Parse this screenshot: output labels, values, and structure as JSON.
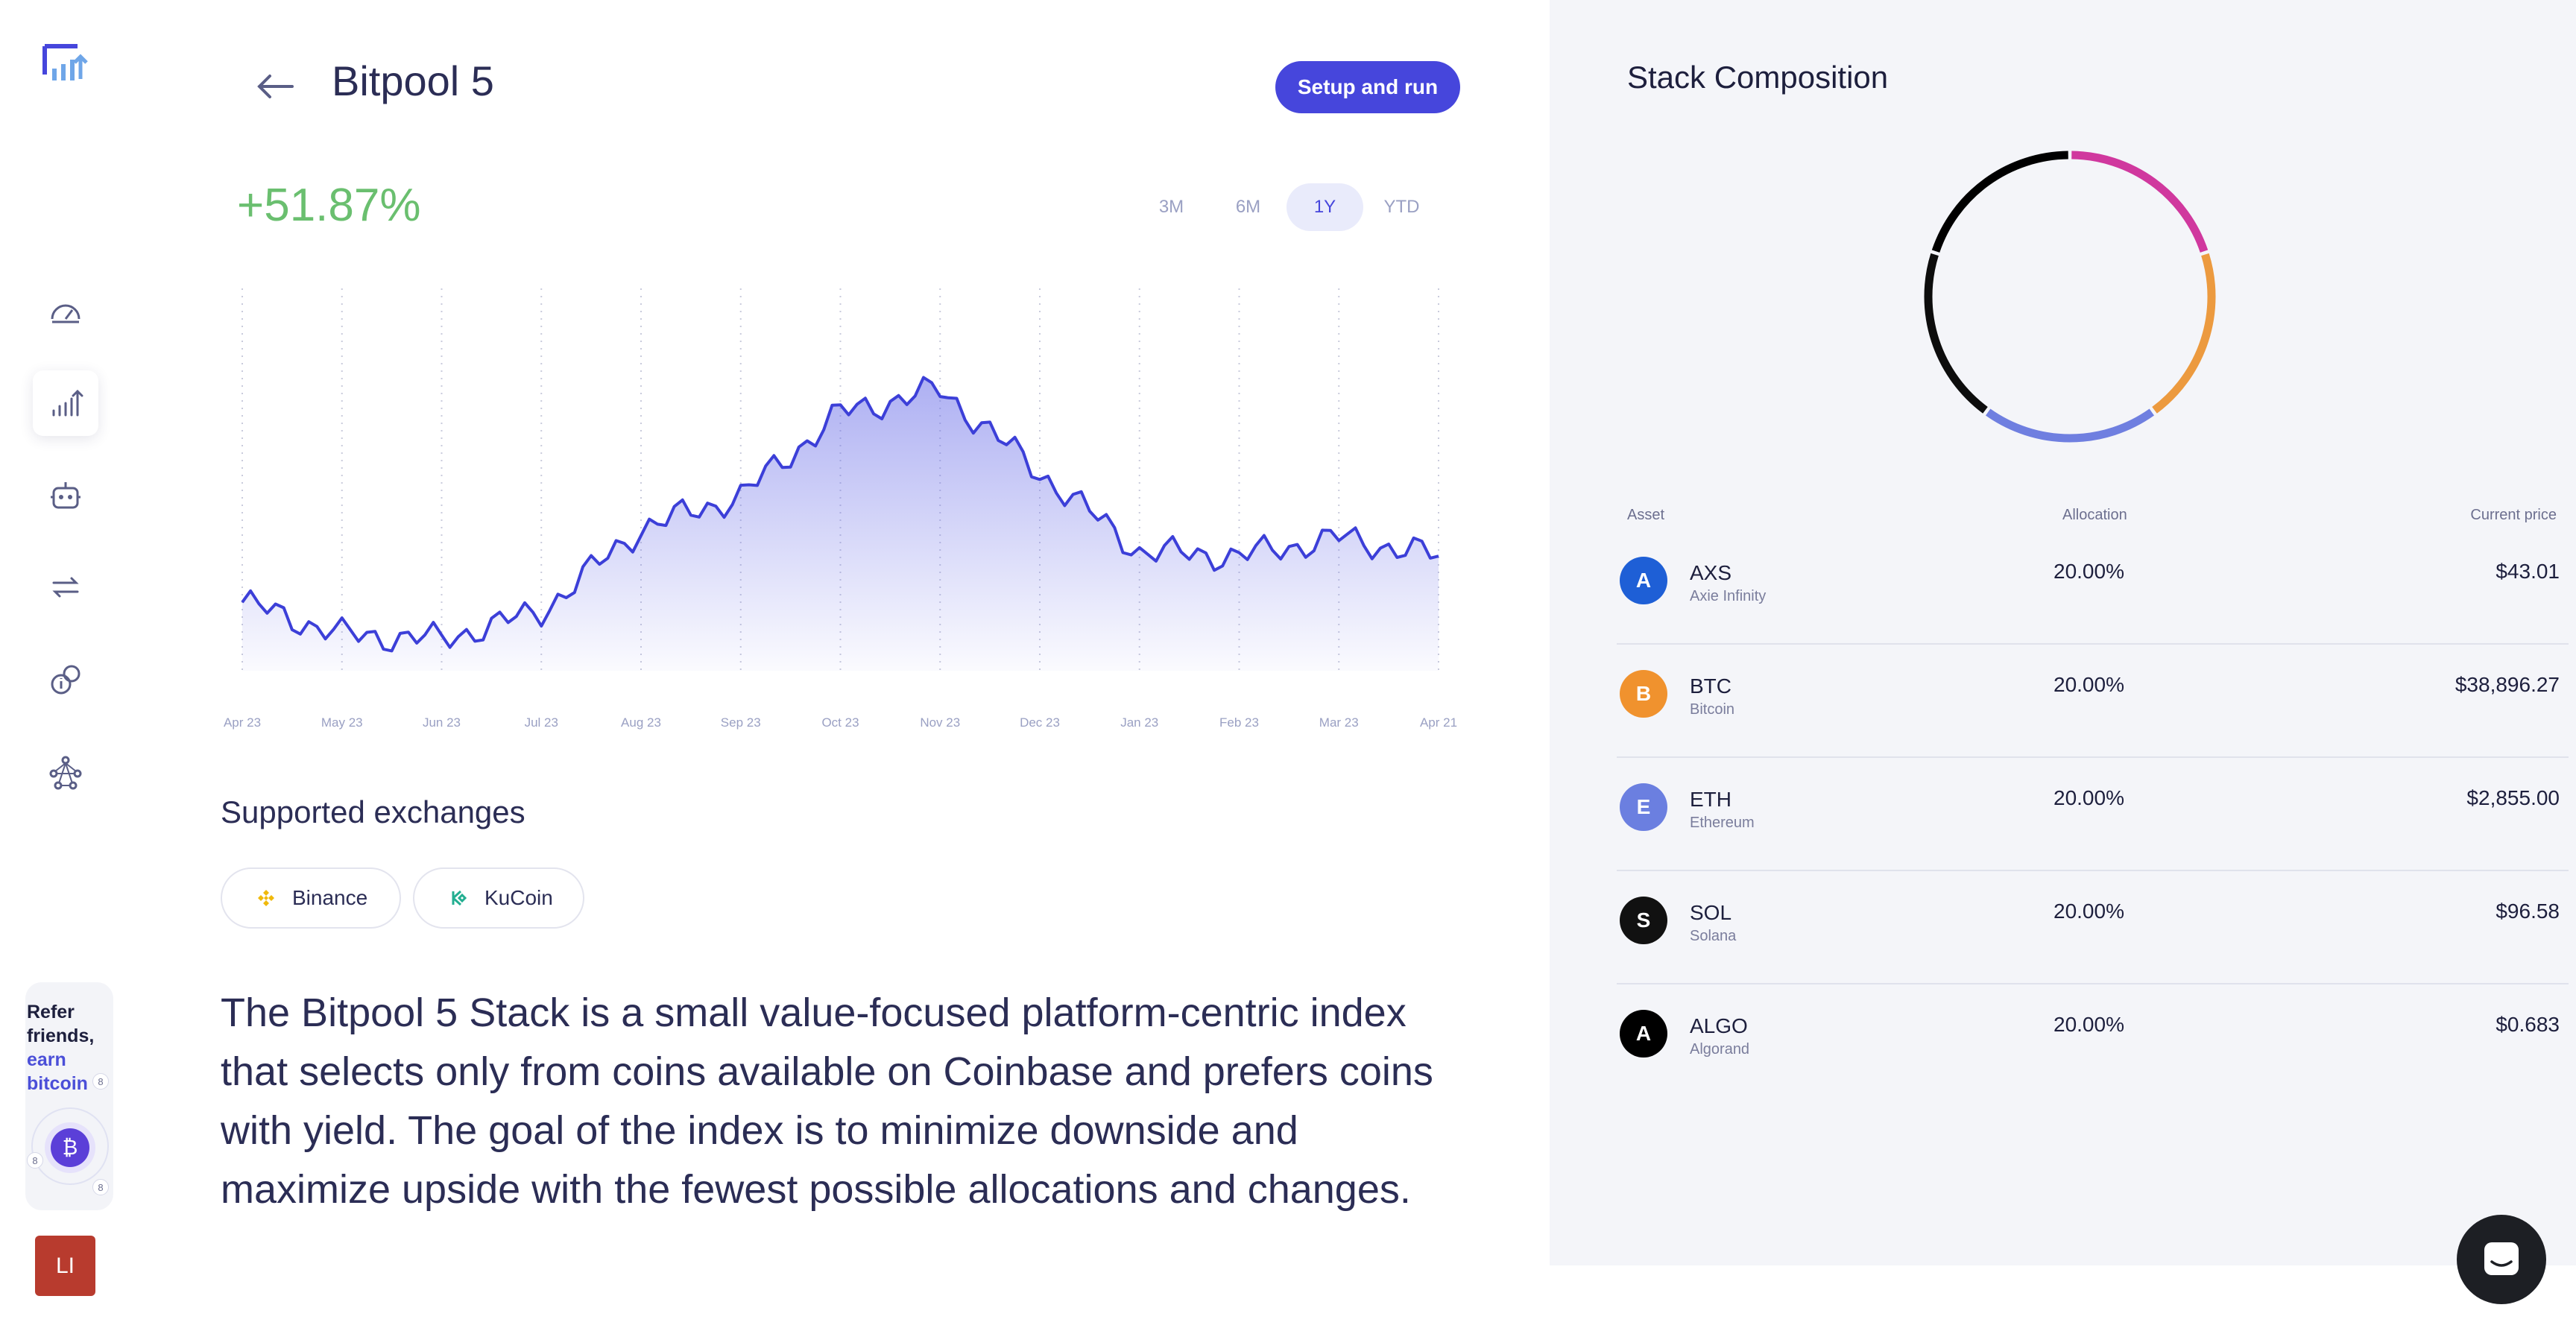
{
  "header": {
    "title": "Bitpool 5",
    "setup_label": "Setup and run"
  },
  "performance": {
    "change": "+51.87%"
  },
  "ranges": [
    {
      "label": "3M",
      "active": false
    },
    {
      "label": "6M",
      "active": false
    },
    {
      "label": "1Y",
      "active": true
    },
    {
      "label": "YTD",
      "active": false
    }
  ],
  "chart_data": {
    "type": "area",
    "title": "",
    "x": [
      "Apr 23",
      "May 23",
      "Jun 23",
      "Jul 23",
      "Aug 23",
      "Sep 23",
      "Oct 23",
      "Nov 23",
      "Dec 23",
      "Jan 23",
      "Feb 23",
      "Mar 23",
      "Apr 21"
    ],
    "series": [
      {
        "values": [
          14,
          7,
          6,
          12,
          30,
          37,
          55,
          60,
          42,
          25,
          24,
          28,
          24
        ]
      }
    ],
    "grid": "vertical-dotted",
    "color": "#3c3fd8"
  },
  "exchanges_heading": "Supported exchanges",
  "exchanges": [
    {
      "label": "Binance",
      "color": "#f0b90b"
    },
    {
      "label": "KuCoin",
      "color": "#23af91"
    }
  ],
  "description": "The Bitpool 5 Stack is a small value-focused platform-centric index that selects only from coins available on Coinbase and prefers coins with yield. The goal of the index is to minimize downside and maximize upside with the fewest possible allocations and changes.",
  "sidebar": {
    "refer_line1": "Refer",
    "refer_line2": "friends,",
    "refer_line3": "earn",
    "refer_line4": "bitcoin",
    "refer_badge": "8",
    "avatar_initials": "LI"
  },
  "composition": {
    "title": "Stack Composition",
    "columns": {
      "asset": "Asset",
      "allocation": "Allocation",
      "price": "Current price"
    },
    "donut": [
      {
        "name": "AXS",
        "value": 20,
        "color": "#d0389e"
      },
      {
        "name": "BTC",
        "value": 20,
        "color": "#ec9a3f"
      },
      {
        "name": "ETH",
        "value": 20,
        "color": "#6f7fe0"
      },
      {
        "name": "SOL",
        "value": 20,
        "color": "#0d0d0d"
      },
      {
        "name": "ALGO",
        "value": 20,
        "color": "#000000"
      }
    ],
    "rows": [
      {
        "symbol": "AXS",
        "name": "Axie Infinity",
        "allocation": "20.00%",
        "price": "$43.01",
        "color": "#1e5fd6"
      },
      {
        "symbol": "BTC",
        "name": "Bitcoin",
        "allocation": "20.00%",
        "price": "$38,896.27",
        "color": "#f0922e"
      },
      {
        "symbol": "ETH",
        "name": "Ethereum",
        "allocation": "20.00%",
        "price": "$2,855.00",
        "color": "#6b7fe0"
      },
      {
        "symbol": "SOL",
        "name": "Solana",
        "allocation": "20.00%",
        "price": "$96.58",
        "color": "#111111"
      },
      {
        "symbol": "ALGO",
        "name": "Algorand",
        "allocation": "20.00%",
        "price": "$0.683",
        "color": "#000000"
      }
    ]
  }
}
